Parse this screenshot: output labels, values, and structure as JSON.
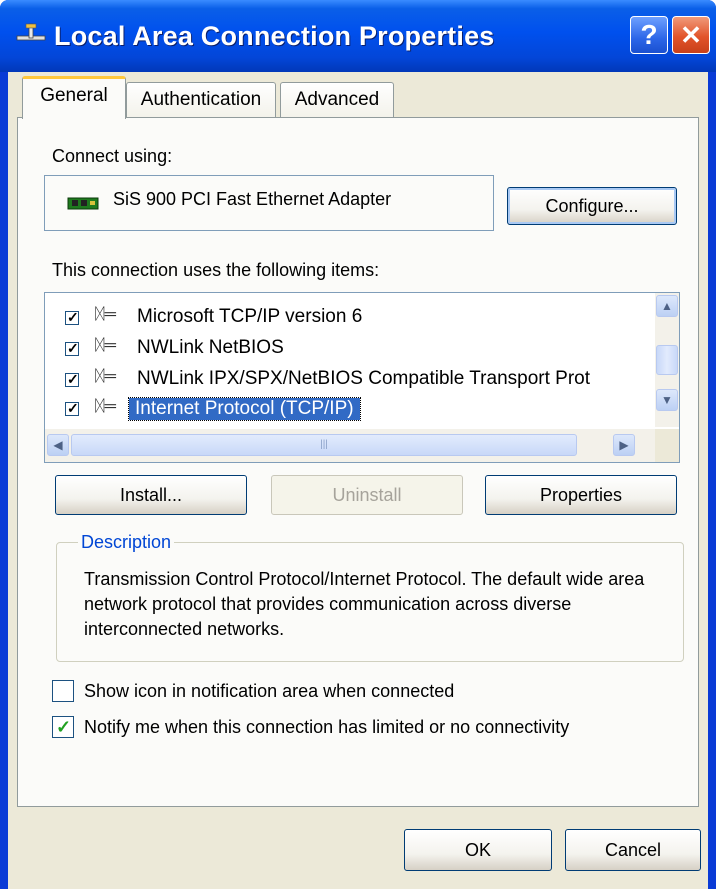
{
  "window": {
    "title": "Local Area Connection Properties"
  },
  "tabs": [
    {
      "label": "General",
      "active": true
    },
    {
      "label": "Authentication",
      "active": false
    },
    {
      "label": "Advanced",
      "active": false
    }
  ],
  "connect_using": {
    "label": "Connect using:",
    "adapter_name": "SiS 900 PCI Fast Ethernet Adapter",
    "configure_label": "Configure..."
  },
  "items": {
    "label": "This connection uses the following items:",
    "rows": [
      {
        "label": "Microsoft TCP/IP version 6",
        "checked": true,
        "selected": false
      },
      {
        "label": "NWLink NetBIOS",
        "checked": true,
        "selected": false
      },
      {
        "label": "NWLink IPX/SPX/NetBIOS Compatible Transport Prot",
        "checked": true,
        "selected": false
      },
      {
        "label": "Internet Protocol (TCP/IP)",
        "checked": true,
        "selected": true
      }
    ]
  },
  "buttons": {
    "install": "Install...",
    "uninstall": "Uninstall",
    "properties": "Properties",
    "ok": "OK",
    "cancel": "Cancel"
  },
  "description": {
    "legend": "Description",
    "text": "Transmission Control Protocol/Internet Protocol. The default wide area network protocol that provides communication across diverse interconnected networks."
  },
  "options": {
    "show_icon": {
      "label": "Show icon in notification area when connected",
      "checked": false
    },
    "notify": {
      "label": "Notify me when this connection has limited or no connectivity",
      "checked": true
    }
  },
  "colors": {
    "title_bar": "#0050ee",
    "dialog_bg": "#ece9d8",
    "selection": "#316ac5",
    "accent_link": "#0046d5"
  }
}
